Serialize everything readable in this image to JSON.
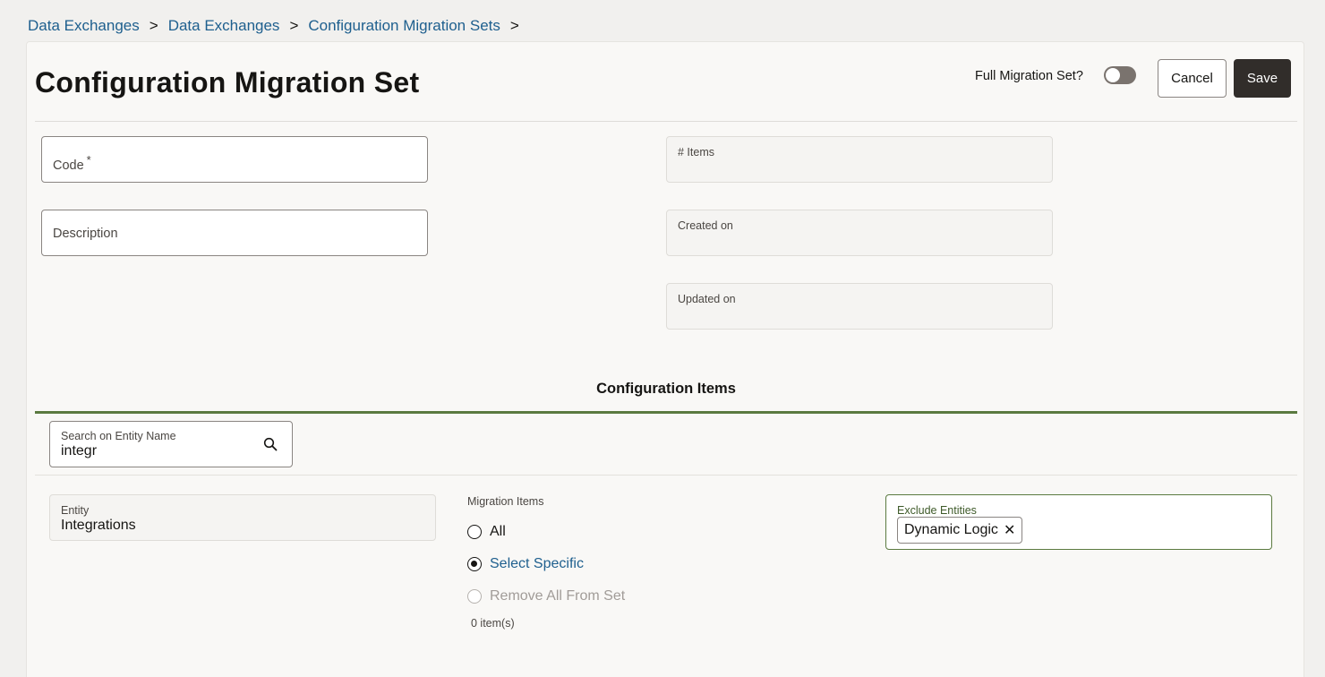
{
  "breadcrumb": {
    "items": [
      "Data Exchanges",
      "Data Exchanges",
      "Configuration Migration Sets"
    ],
    "separator": ">"
  },
  "header": {
    "title": "Configuration Migration Set",
    "full_migration_label": "Full Migration Set?",
    "full_migration_on": false,
    "cancel_label": "Cancel",
    "save_label": "Save"
  },
  "form": {
    "code_label": "Code",
    "code_required_mark": "*",
    "description_label": "Description",
    "items_label": "# Items",
    "created_label": "Created on",
    "updated_label": "Updated on"
  },
  "config_items": {
    "section_title": "Configuration Items",
    "search_label": "Search on Entity Name",
    "search_value": "integr",
    "entity_label": "Entity",
    "entity_value": "Integrations",
    "migration_items_label": "Migration Items",
    "options": [
      {
        "label": "All",
        "checked": false,
        "disabled": false
      },
      {
        "label": "Select Specific",
        "checked": true,
        "disabled": false
      },
      {
        "label": "Remove All From Set",
        "checked": false,
        "disabled": true
      }
    ],
    "count_text": "0 item(s)",
    "exclude_label": "Exclude Entities",
    "exclude_chips": [
      "Dynamic Logic"
    ],
    "chip_remove_glyph": "✕"
  },
  "colors": {
    "accent_green": "#5b7a40",
    "link_blue": "#1e5f8e",
    "save_bg": "#312d2a"
  },
  "icons": {
    "search": "search-icon",
    "remove_chip": "close-icon"
  }
}
